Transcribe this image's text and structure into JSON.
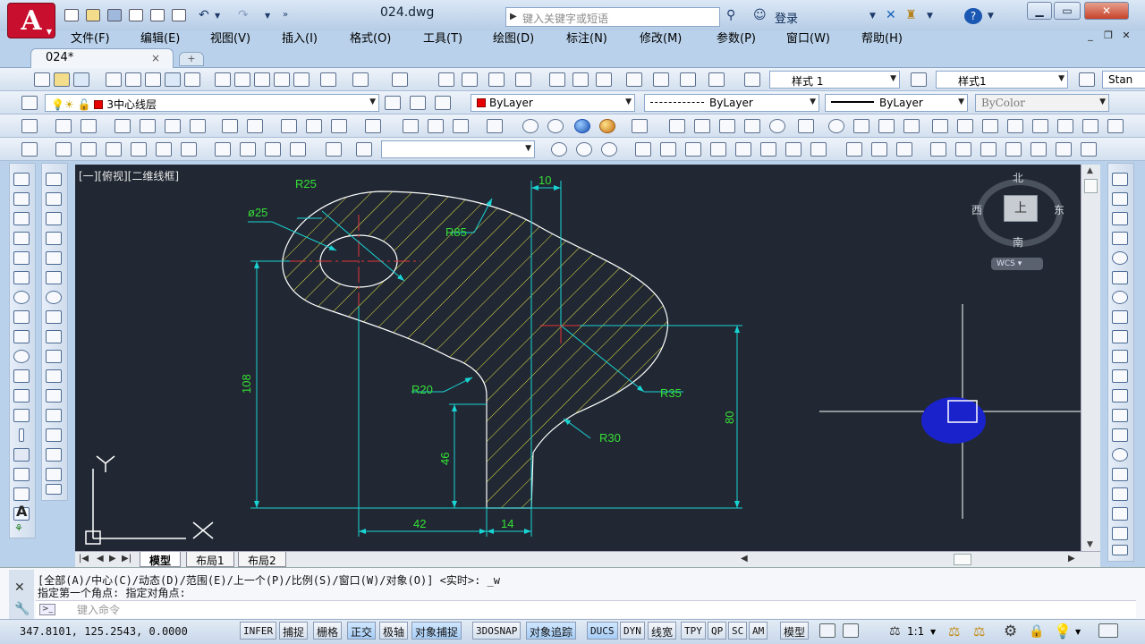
{
  "title_bar": {
    "app_logo": "A",
    "document_title": "024.dwg",
    "search_placeholder": "键入关键字或短语",
    "login_label": "登录",
    "help_label": "?"
  },
  "menu": [
    "文件(F)",
    "编辑(E)",
    "视图(V)",
    "插入(I)",
    "格式(O)",
    "工具(T)",
    "绘图(D)",
    "标注(N)",
    "修改(M)",
    "参数(P)",
    "窗口(W)",
    "帮助(H)"
  ],
  "doc_tab": {
    "label": "024*",
    "close": "×"
  },
  "styles_toolbar": {
    "text_style": "样式 1",
    "dim_style": "样式1",
    "table_style": "Stan"
  },
  "layers_toolbar": {
    "current_layer": "3中心线层"
  },
  "properties_toolbar": {
    "color": "ByLayer",
    "linetype": "ByLayer",
    "lineweight": "ByLayer",
    "plot_style": "ByColor"
  },
  "accent_colors": {
    "background": "#212833",
    "outline": "#ffffff",
    "hatch": "#e8e844",
    "dimension": "#19d4d4",
    "dimension_text": "#35e035",
    "centerline": "#e33434",
    "viewcube_marker": "#1a22cc"
  },
  "viewport": {
    "view_label": "[一][俯视][二维线框]",
    "viewcube": {
      "north": "北",
      "south": "南",
      "east": "东",
      "west": "西",
      "face": "上",
      "wcs": "WCS"
    },
    "ucs_labels": {
      "x": "X",
      "y": "Y"
    },
    "annotations": {
      "r25": "R25",
      "d25": "ø25",
      "r85": "R85",
      "dim10": "10",
      "dim108": "108",
      "r20": "R20",
      "dim46": "46",
      "r35": "R35",
      "r30": "R30",
      "dim80": "80",
      "dim42": "42",
      "dim14": "14"
    }
  },
  "layout_tabs": [
    "模型",
    "布局1",
    "布局2"
  ],
  "command": {
    "history": [
      "[全部(A)/中心(C)/动态(D)/范围(E)/上一个(P)/比例(S)/窗口(W)/对象(O)] <实时>: _w",
      "指定第一个角点: 指定对角点:"
    ],
    "placeholder": "键入命令"
  },
  "status": {
    "coords": "347.8101, 125.2543, 0.0000",
    "toggles": [
      "INFER",
      "捕捉",
      "栅格",
      "正交",
      "极轴",
      "对象捕捉",
      "3DOSNAP",
      "对象追踪",
      "DUCS",
      "DYN",
      "线宽",
      "TPY",
      "QP",
      "SC",
      "AM"
    ],
    "model_label": "模型",
    "scale": "1:1"
  }
}
